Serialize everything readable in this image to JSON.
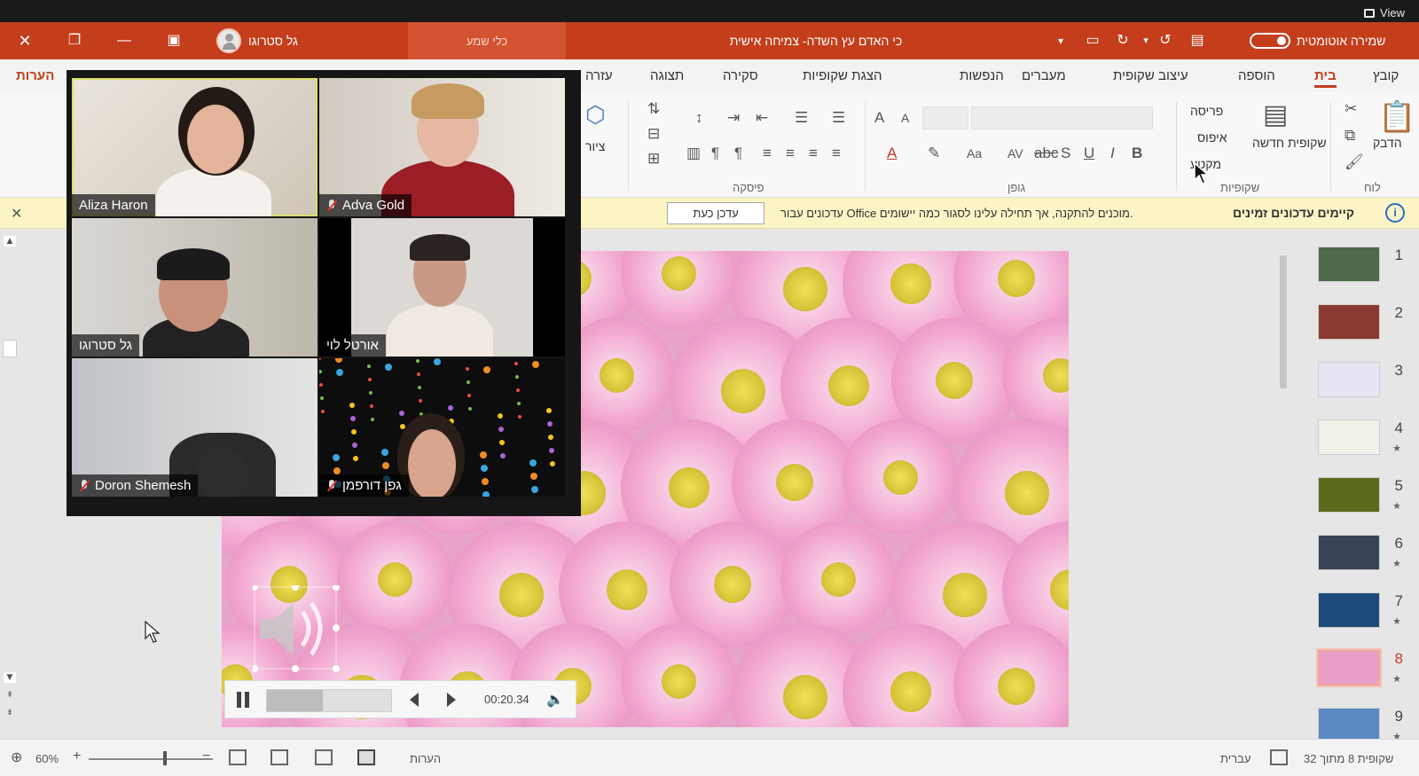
{
  "zoom": {
    "view_label": "View",
    "participants": [
      {
        "name": "Aliza Haron",
        "muted": false,
        "speaking": true
      },
      {
        "name": "Adva Gold",
        "muted": true,
        "speaking": false
      },
      {
        "name": "גל סטרוגו",
        "muted": false,
        "speaking": false
      },
      {
        "name": "אורטל לוי",
        "muted": false,
        "speaking": false
      },
      {
        "name": "Doron Shemesh",
        "muted": true,
        "speaking": false
      },
      {
        "name": "גפן דורפמן",
        "muted": true,
        "speaking": false
      }
    ]
  },
  "titlebar": {
    "autosave_label": "שמירה אוטומטית",
    "document_title": "כי האדם עץ השדה- צמיחה אישית",
    "search_placeholder": "כלי שמע",
    "user_name": "גל סטרוגו"
  },
  "ribbon": {
    "tabs": [
      "קובץ",
      "בית",
      "הוספה",
      "עיצוב שקופית",
      "מעברים",
      "הנפשות",
      "הצגת שקופיות",
      "סקירה",
      "תצוגה",
      "עזרה"
    ],
    "active_tab": "בית",
    "notes_tab": "הערות",
    "clipboard": {
      "paste_label": "הדבק",
      "group_label": "לוח"
    },
    "slides": {
      "new_slide_label": "שקופית חדשה",
      "layout_label": "פריסה",
      "reset_label": "איפוס",
      "section_label": "מקטע",
      "group_label": "שקופיות"
    },
    "font": {
      "group_label": "גופן"
    },
    "paragraph": {
      "group_label": "פיסקה"
    },
    "drawing_label": "ציור"
  },
  "notice": {
    "title": "קיימים עדכונים זמינים",
    "text": "עדכונים עבור Office מוכנים להתקנה, אך תחילה עלינו לסגור כמה יישומים.",
    "button_label": "עדכן כעת"
  },
  "media": {
    "time": "00:20.34",
    "progress": 0.45
  },
  "thumbnails": [
    {
      "num": "1",
      "color": "#4d6a4a",
      "star": false
    },
    {
      "num": "2",
      "color": "#8a3a30",
      "star": false
    },
    {
      "num": "3",
      "color": "#e8e4f2",
      "star": false
    },
    {
      "num": "4",
      "color": "#eef2e8",
      "star": true
    },
    {
      "num": "5",
      "color": "#5a6a1c",
      "star": true
    },
    {
      "num": "6",
      "color": "#3a4256",
      "star": true
    },
    {
      "num": "7",
      "color": "#1e4a7a",
      "star": true
    },
    {
      "num": "8",
      "color": "#e9a0c8",
      "star": true,
      "active": true
    },
    {
      "num": "9",
      "color": "#5a8ac4",
      "star": true
    }
  ],
  "statusbar": {
    "slide_counter": "שקופית 8 מתוך 32",
    "language": "עברית",
    "notes_label": "הערות",
    "zoom_level": "60%"
  },
  "colors": {
    "accent": "#c43e1c",
    "notice_bg": "#fcf4c5",
    "slide_pink": "#e7a3c8"
  }
}
